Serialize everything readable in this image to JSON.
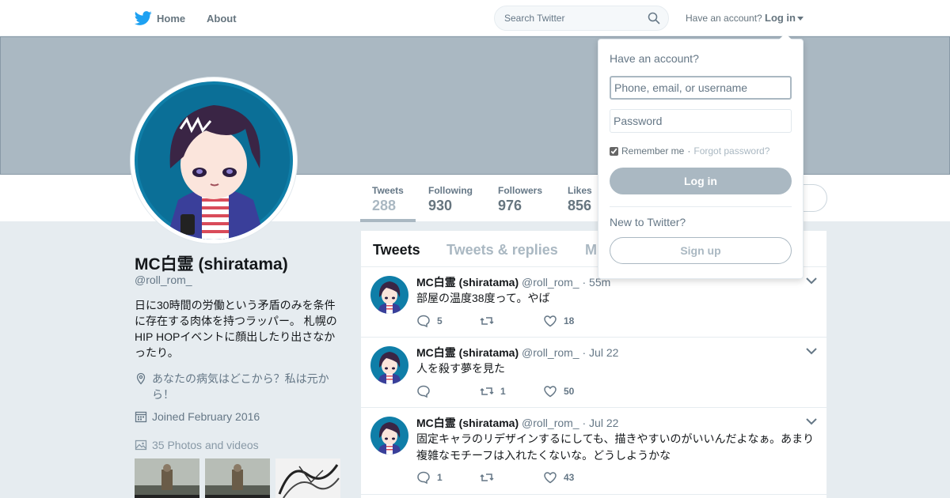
{
  "topbar": {
    "home_label": "Home",
    "about_label": "About",
    "search_placeholder": "Search Twitter",
    "account_question": "Have an account?",
    "login_label": "Log in"
  },
  "profile_nav": {
    "stats": [
      {
        "label": "Tweets",
        "value": "288"
      },
      {
        "label": "Following",
        "value": "930"
      },
      {
        "label": "Followers",
        "value": "976"
      },
      {
        "label": "Likes",
        "value": "856"
      }
    ]
  },
  "profile": {
    "name": "MC白霊 (shiratama)",
    "handle": "@roll_rom_",
    "bio": "日に30時間の労働という矛盾のみを条件に存在する肉体を持つラッパー。 札幌のHIP HOPイベントに顔出したり出さなかったり。",
    "location": "あなたの病気はどこから？私は元から！",
    "joined": "Joined February 2016",
    "photos_label": "35 Photos and videos"
  },
  "timeline": {
    "tabs": [
      "Tweets",
      "Tweets & replies",
      "M"
    ],
    "tweets": [
      {
        "name": "MC白霊 (shiratama)",
        "handle": "@roll_rom_",
        "time": "· 55m",
        "text": "部屋の温度38度って。やば",
        "replies": "5",
        "retweets": "",
        "likes": "18"
      },
      {
        "name": "MC白霊 (shiratama)",
        "handle": "@roll_rom_",
        "time": "· Jul 22",
        "text": "人を殺す夢を見た",
        "replies": "",
        "retweets": "1",
        "likes": "50"
      },
      {
        "name": "MC白霊 (shiratama)",
        "handle": "@roll_rom_",
        "time": "· Jul 22",
        "text": "固定キャラのリデザインするにしても、描きやすいのがいいんだよなぁ。あまり複雑なモチーフは入れたくないな。どうしようかな",
        "replies": "1",
        "retweets": "",
        "likes": "43"
      }
    ]
  },
  "login_dropdown": {
    "heading": "Have an account?",
    "username_placeholder": "Phone, email, or username",
    "password_placeholder": "Password",
    "remember_label": "Remember me",
    "separator": "·",
    "forgot_label": "Forgot password?",
    "login_button": "Log in",
    "new_prompt": "New to Twitter?",
    "signup_button": "Sign up"
  },
  "colors": {
    "accent_gray": "#aab8c2",
    "twitter_blue": "#1da1f2",
    "muted_text": "#657786"
  }
}
